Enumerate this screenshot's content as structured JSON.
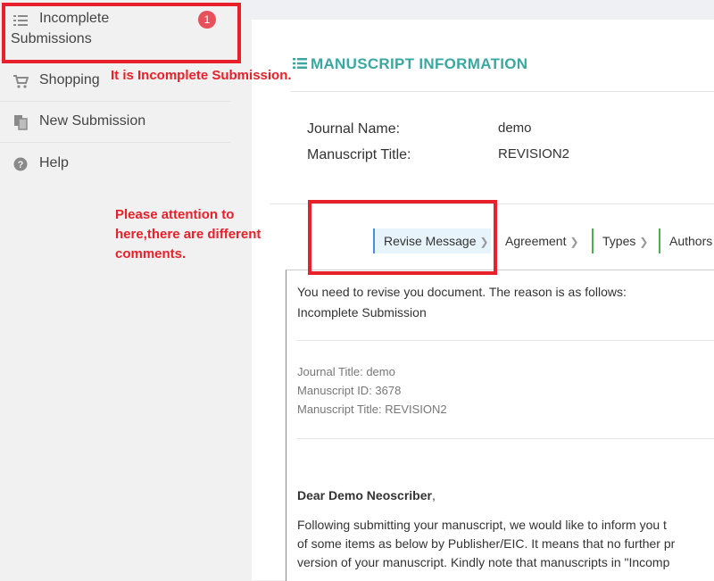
{
  "sidebar": {
    "items": [
      {
        "label_line1": "Incomplete",
        "label_line2": "Submissions",
        "icon": "list-icon",
        "badge": "1"
      },
      {
        "label": "Shopping",
        "icon": "cart-icon"
      },
      {
        "label": "New Submission",
        "icon": "copy-icon"
      },
      {
        "label": "Help",
        "icon": "help-icon"
      }
    ]
  },
  "annotations": {
    "incomplete": "It is Incomplete Submission.",
    "attention_line1": "Please attention to",
    "attention_line2": "here,there are different",
    "attention_line3": "comments."
  },
  "main": {
    "title": "MANUSCRIPT INFORMATION",
    "journal_name_label": "Journal Name:",
    "journal_name_value": "demo",
    "manuscript_title_label": "Manuscript Title:",
    "manuscript_title_value": "REVISION2"
  },
  "tabs": [
    {
      "label": "Revise Message"
    },
    {
      "label": "Agreement"
    },
    {
      "label": "Types"
    },
    {
      "label": "Authors"
    }
  ],
  "message": {
    "line1": "You need to revise you document. The reason is as follows:",
    "line2": "Incomplete Submission",
    "journal_title": "Journal Title: demo",
    "manuscript_id": "Manuscript ID: 3678",
    "manuscript_title": "Manuscript Title: REVISION2",
    "greeting_prefix": "Dear Demo Neoscriber",
    "greeting_suffix": ",",
    "body1": "Following submitting your manuscript, we would like to inform you t",
    "body2": "of some items as below by Publisher/EIC. It means that no further pr",
    "body3": "version of your manuscript. Kindly note that manuscripts in \"Incomp"
  }
}
